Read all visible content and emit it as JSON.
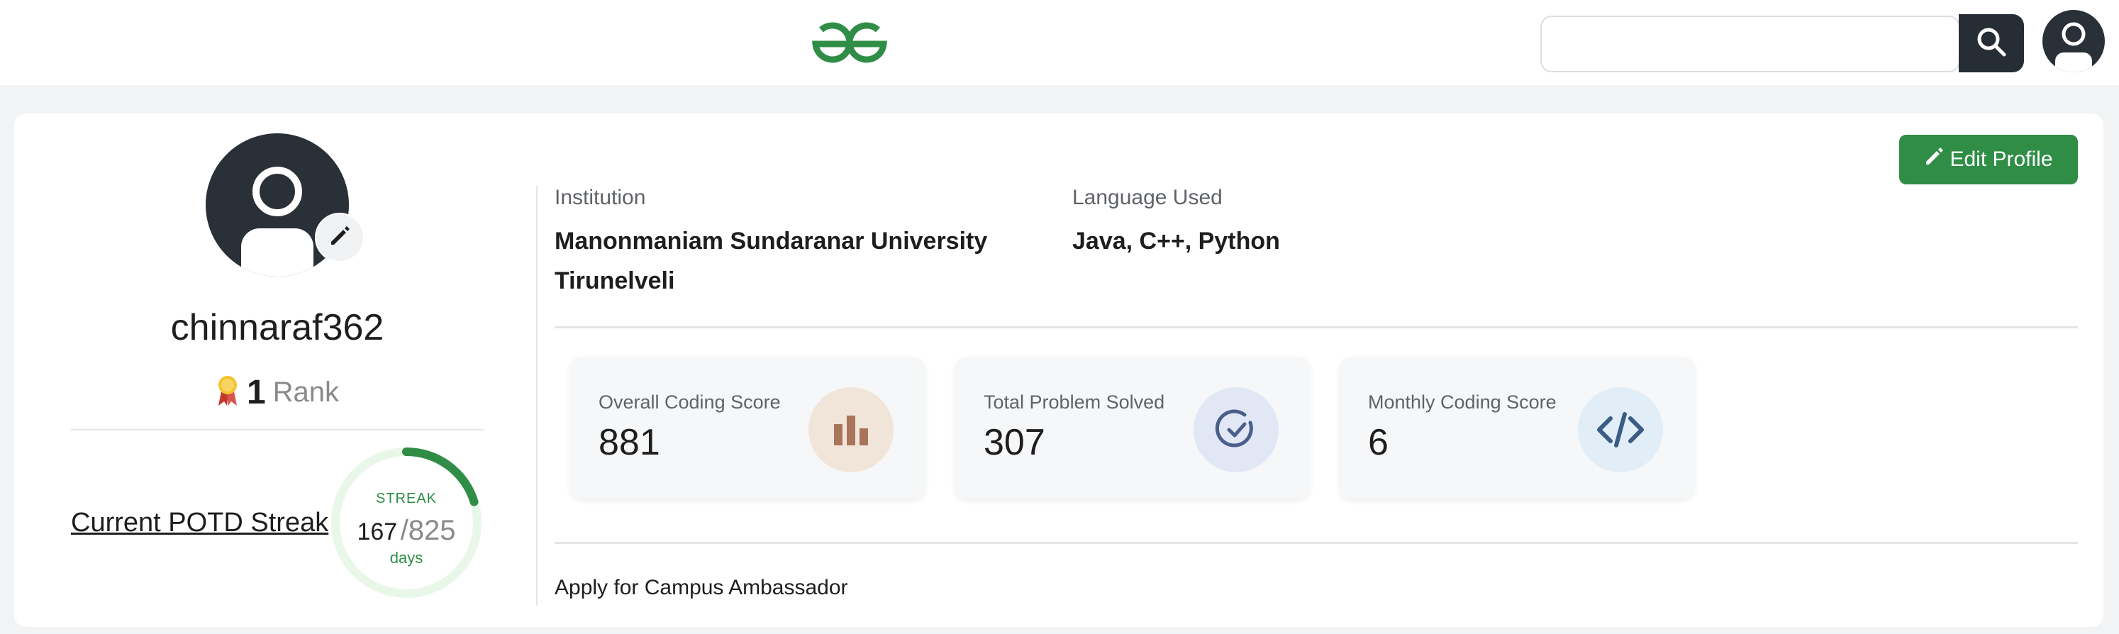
{
  "header": {
    "logo_icon": "gfg-logo-icon",
    "search": {
      "placeholder": "",
      "value": "",
      "button_icon": "search-icon"
    },
    "avatar_icon": "user-avatar-icon"
  },
  "profile": {
    "avatar_icon": "user-avatar-icon",
    "edit_avatar_icon": "pencil-icon",
    "username": "chinnaraf362",
    "rank_badge_icon": "medal-icon",
    "rank_value": "1",
    "rank_label": "Rank",
    "potd_link": "Current POTD Streak",
    "streak": {
      "label": "STREAK",
      "current": "167",
      "max": "/825",
      "unit": "days",
      "progress_fraction": 0.2024
    }
  },
  "actions": {
    "edit_profile_label": "Edit Profile",
    "edit_profile_icon": "pencil-icon"
  },
  "info": {
    "institution_label": "Institution",
    "institution_value": "Manonmaniam Sundaranar University Tirunelveli",
    "language_label": "Language Used",
    "language_value": "Java, C++, Python"
  },
  "stats": [
    {
      "label": "Overall Coding Score",
      "value": "881",
      "icon": "bar-chart-icon"
    },
    {
      "label": "Total Problem Solved",
      "value": "307",
      "icon": "check-circle-icon"
    },
    {
      "label": "Monthly Coding Score",
      "value": "6",
      "icon": "code-icon"
    }
  ],
  "footer": {
    "ambassador_text": "Apply for Campus Ambassador"
  },
  "colors": {
    "brand_green": "#2f8d46",
    "dark": "#262d35",
    "streak_track": "#e8f7e8"
  }
}
